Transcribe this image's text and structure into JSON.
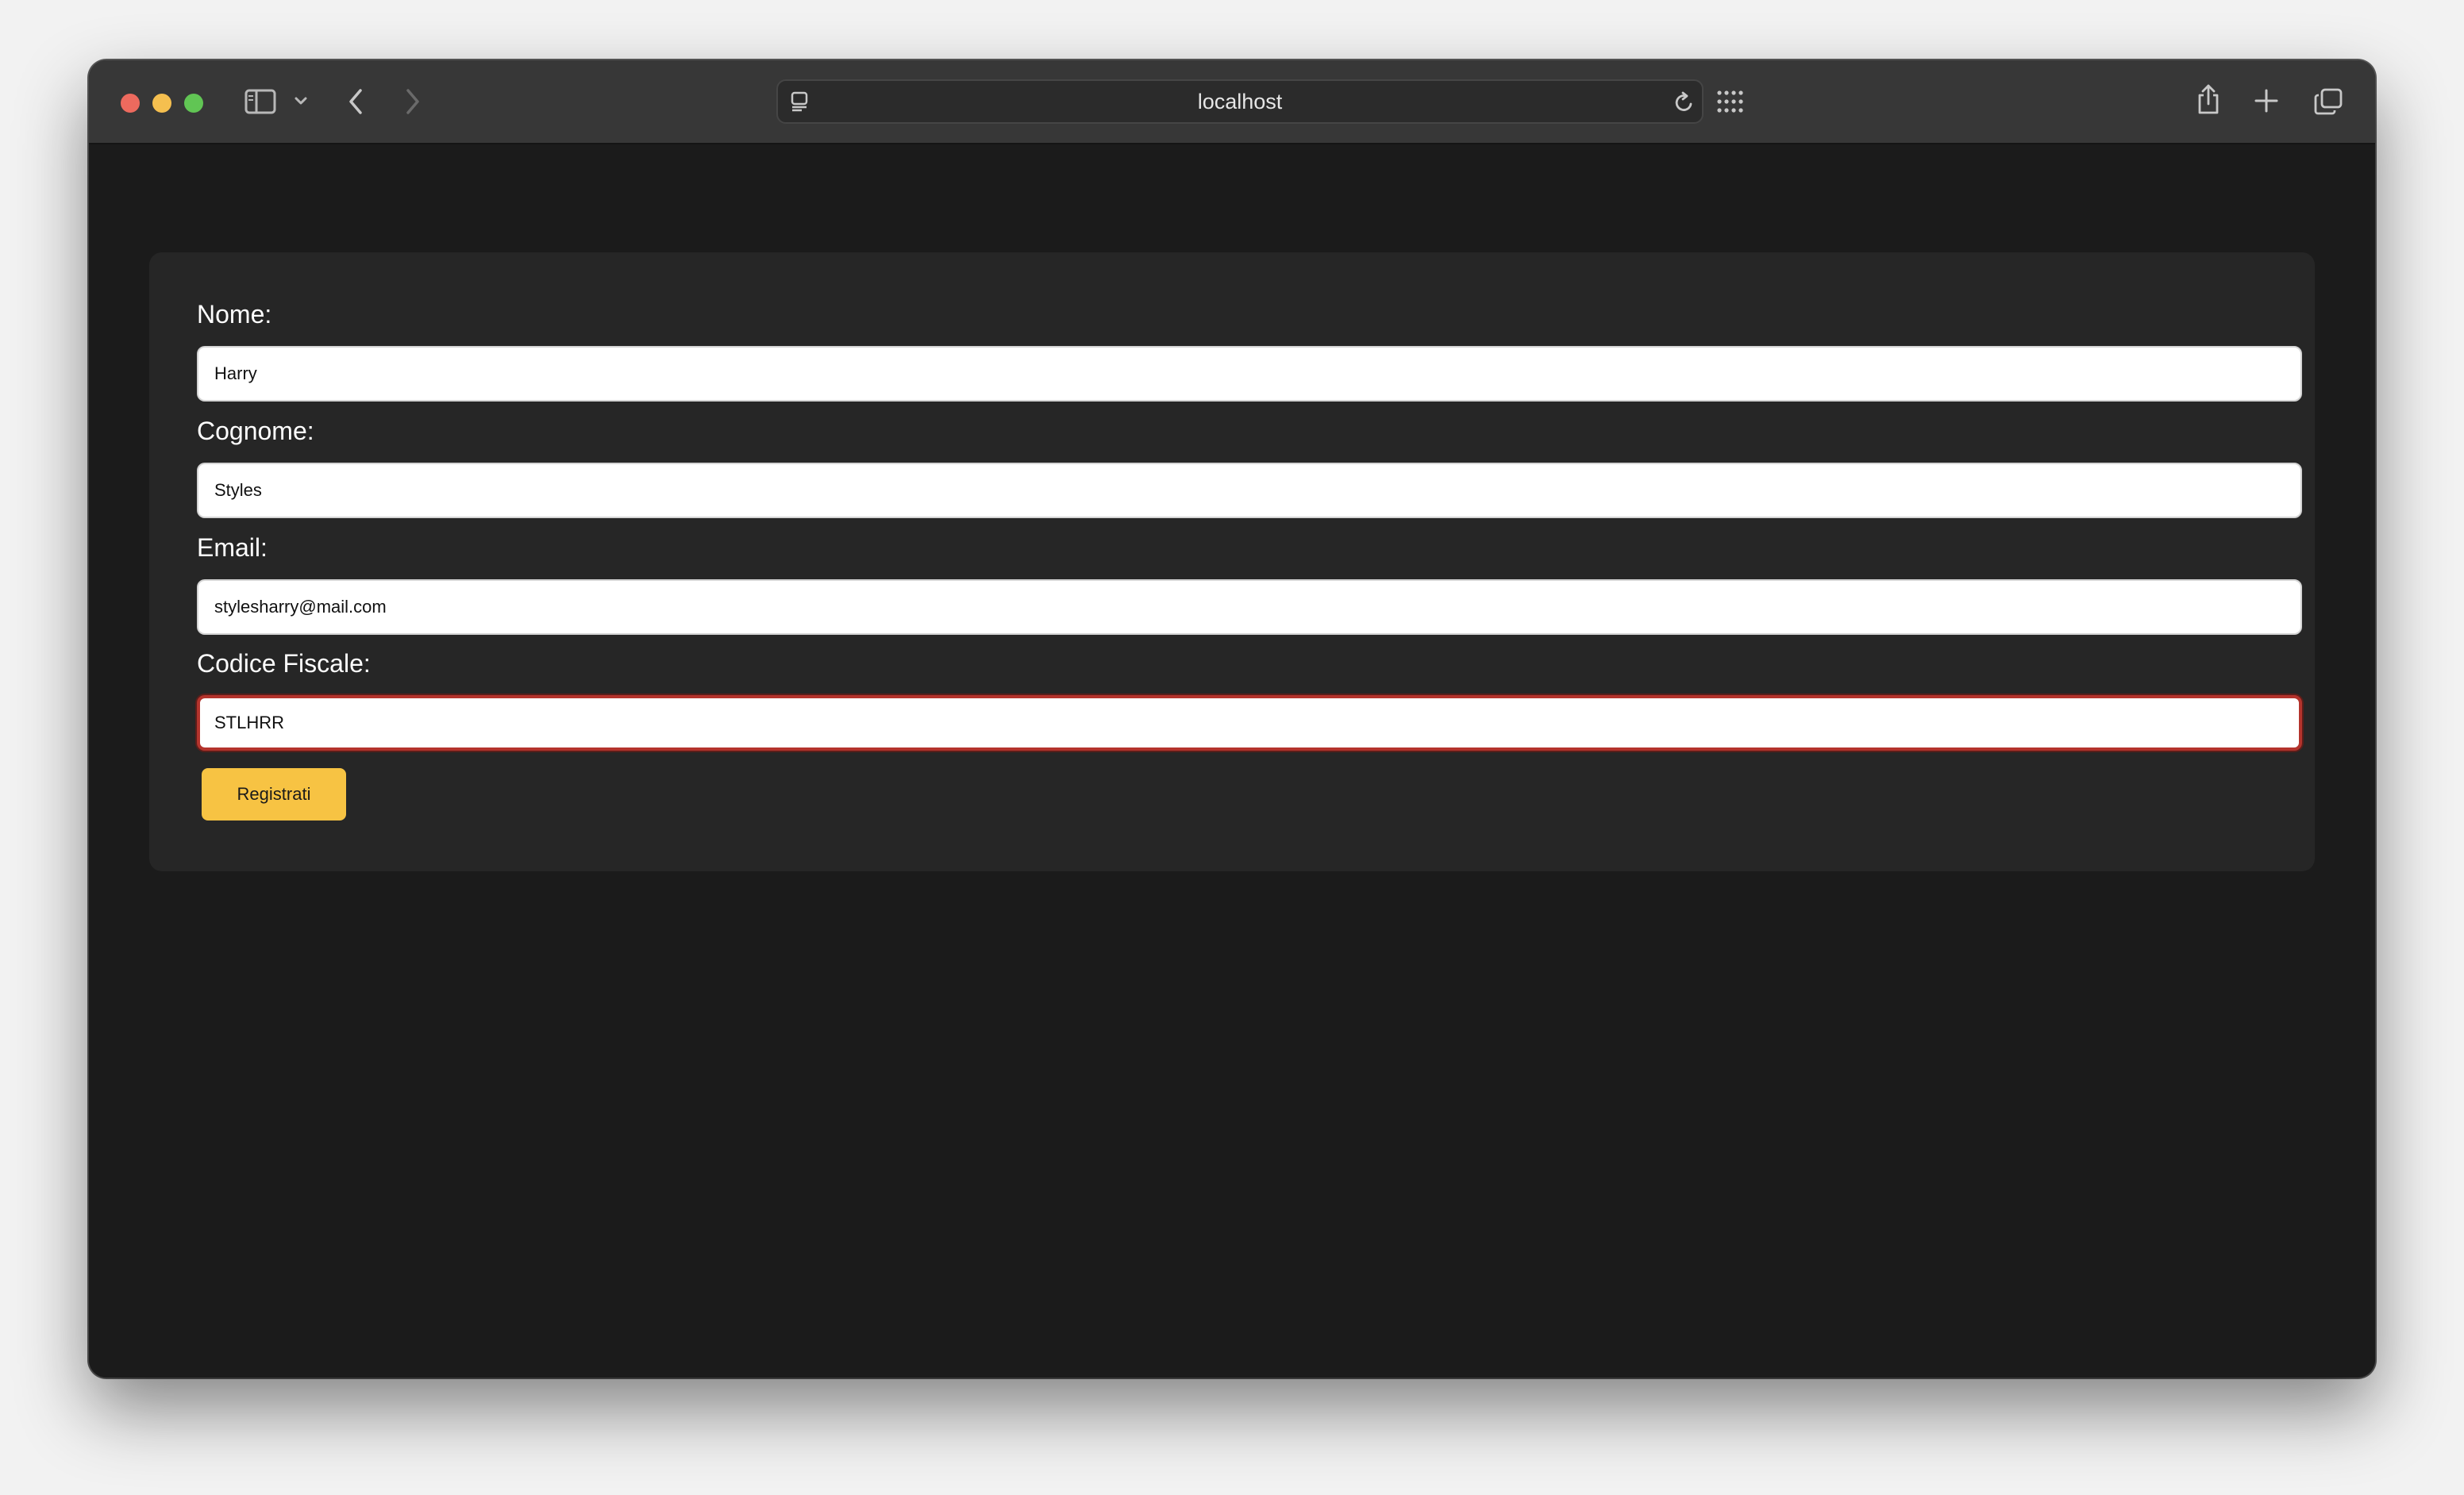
{
  "browser": {
    "address": "localhost",
    "icons": {
      "sidebar": "sidebar-icon",
      "chevron": "chevron-down-icon",
      "back": "back-arrow-icon",
      "forward": "forward-arrow-icon",
      "page_menu": "page-menu-icon",
      "reload": "reload-icon",
      "grid": "grid-icon",
      "share": "share-icon",
      "new_tab": "plus-icon",
      "tabs": "tabs-overview-icon"
    }
  },
  "form": {
    "nome": {
      "label": "Nome:",
      "value": "Harry"
    },
    "cognome": {
      "label": "Cognome:",
      "value": "Styles"
    },
    "email": {
      "label": "Email:",
      "value": "stylesharry@mail.com"
    },
    "codice_fiscale": {
      "label": "Codice Fiscale:",
      "value": "STLHRR"
    },
    "submit_label": "Registrati"
  },
  "colors": {
    "accent": "#f7c343",
    "invalid_border": "#b3332c",
    "page_background": "#1b1b1b",
    "card_background": "#262626"
  }
}
